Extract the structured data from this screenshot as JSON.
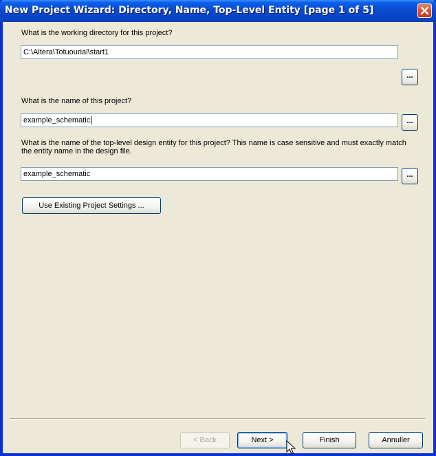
{
  "window": {
    "title": "New Project Wizard: Directory, Name, Top-Level Entity [page 1 of 5]",
    "close_icon": "close-icon"
  },
  "form": {
    "directory": {
      "question": "What is the working directory for this project?",
      "value": "C:\\Altera\\Totuourial\\start1",
      "browse_label": "..."
    },
    "project_name": {
      "question": "What is the name of this project?",
      "value": "example_schematic",
      "browse_label": "..."
    },
    "top_level_entity": {
      "question": "What is the name of the top-level design entity for this project? This name is case sensitive and must exactly match the entity name in the design file.",
      "value": "example_schematic",
      "browse_label": "..."
    },
    "use_existing_label": "Use Existing Project Settings ..."
  },
  "footer": {
    "back_label": "< Back",
    "next_label": "Next >",
    "finish_label": "Finish",
    "cancel_label": "Annuller"
  }
}
